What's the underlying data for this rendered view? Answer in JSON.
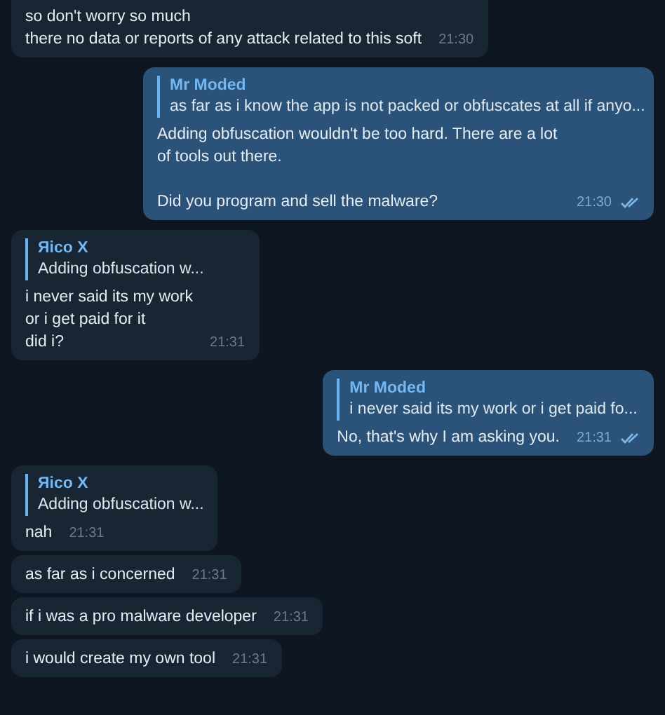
{
  "messages": [
    {
      "kind": "incoming",
      "text": "so don't worry so much\nthere no data or reports of any attack related to this soft",
      "time": "21:30"
    },
    {
      "kind": "outgoing",
      "reply": {
        "name": "Mr Moded",
        "text": "as far as i know the app is not packed or obfuscates at all  if anyo..."
      },
      "text": "Adding obfuscation wouldn't be too hard. There are a lot of tools out there.\n\nDid you program and sell the malware?",
      "time": "21:30",
      "read": true
    },
    {
      "kind": "incoming",
      "reply": {
        "name": "Яico X",
        "text": "Adding obfuscation w..."
      },
      "text": "i never said its my work\nor i get paid for it\ndid i?",
      "time": "21:31"
    },
    {
      "kind": "outgoing",
      "reply": {
        "name": "Mr Moded",
        "text": "i never said its my work or i get paid fo..."
      },
      "text": "No, that's why I am asking you.",
      "time": "21:31",
      "read": true
    },
    {
      "kind": "incoming",
      "reply": {
        "name": "Яico X",
        "text": "Adding obfuscation w..."
      },
      "text": "nah",
      "time": "21:31"
    },
    {
      "kind": "incoming",
      "text": "as far as i concerned",
      "time": "21:31"
    },
    {
      "kind": "incoming",
      "text": "if i was a pro malware developer",
      "time": "21:31"
    },
    {
      "kind": "incoming",
      "text": "i would create my own tool",
      "time": "21:31"
    }
  ]
}
